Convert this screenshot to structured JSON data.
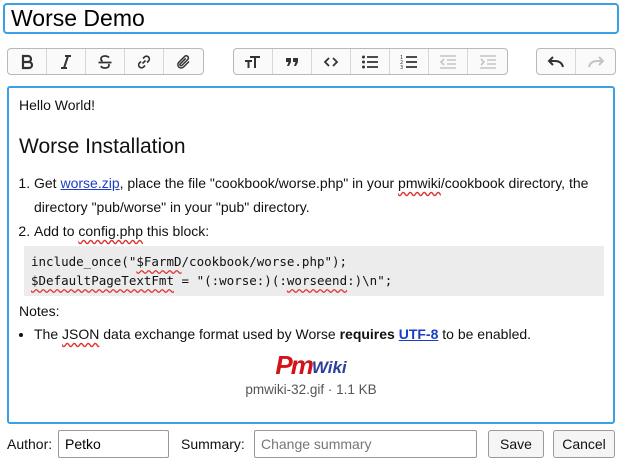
{
  "page_title": "Worse Demo",
  "toolbar": {
    "group1": [
      "bold-icon",
      "italic-icon",
      "strikethrough-icon",
      "link-icon",
      "attach-icon"
    ],
    "group2": [
      "text-size-icon",
      "quote-icon",
      "code-icon",
      "bullet-list-icon",
      "numbered-list-icon",
      "outdent-icon",
      "indent-icon"
    ],
    "group3": [
      "undo-icon",
      "redo-icon"
    ]
  },
  "content": {
    "greeting": "Hello World!",
    "heading": "Worse Installation",
    "step1": {
      "pre": "Get ",
      "link": "worse.zip",
      "mid": ", place the file \"cookbook/worse.php\" in your ",
      "squig": "pmwiki",
      "post": "/cookbook directory, the directory \"pub/worse\" in your \"pub\" directory."
    },
    "step2": {
      "pre": "Add to ",
      "squig": "config.php",
      "post": " this block:"
    },
    "code_line1_a": "include_once(\"",
    "code_line1_b": "$FarmD",
    "code_line1_c": "/cookbook/worse.php\");",
    "code_line2_a": "$DefaultPageTextFmt",
    "code_line2_b": " = \"(:worse:)(:",
    "code_line2_c": "worseend",
    "code_line2_d": ":)\\n\";",
    "notes_label": "Notes:",
    "note1": {
      "pre": "The ",
      "squig": "JSON",
      "mid": " data exchange format used by Worse ",
      "bold": "requires",
      "space": " ",
      "link": "UTF-8",
      "post": " to be enabled."
    }
  },
  "attachment": {
    "logo_pm": "Pm",
    "logo_wiki": "Wiki",
    "filename": "pmwiki-32.gif",
    "separator": " · ",
    "size": "1.1 KB"
  },
  "form": {
    "author_label": "Author:",
    "author_value": "Petko",
    "summary_label": "Summary:",
    "summary_placeholder": "Change summary",
    "save_label": "Save",
    "cancel_label": "Cancel"
  },
  "colors": {
    "accent": "#3aa0e6",
    "link": "#1a3fc4",
    "logo_red": "#d3131a",
    "logo_blue": "#2b3f9d"
  }
}
